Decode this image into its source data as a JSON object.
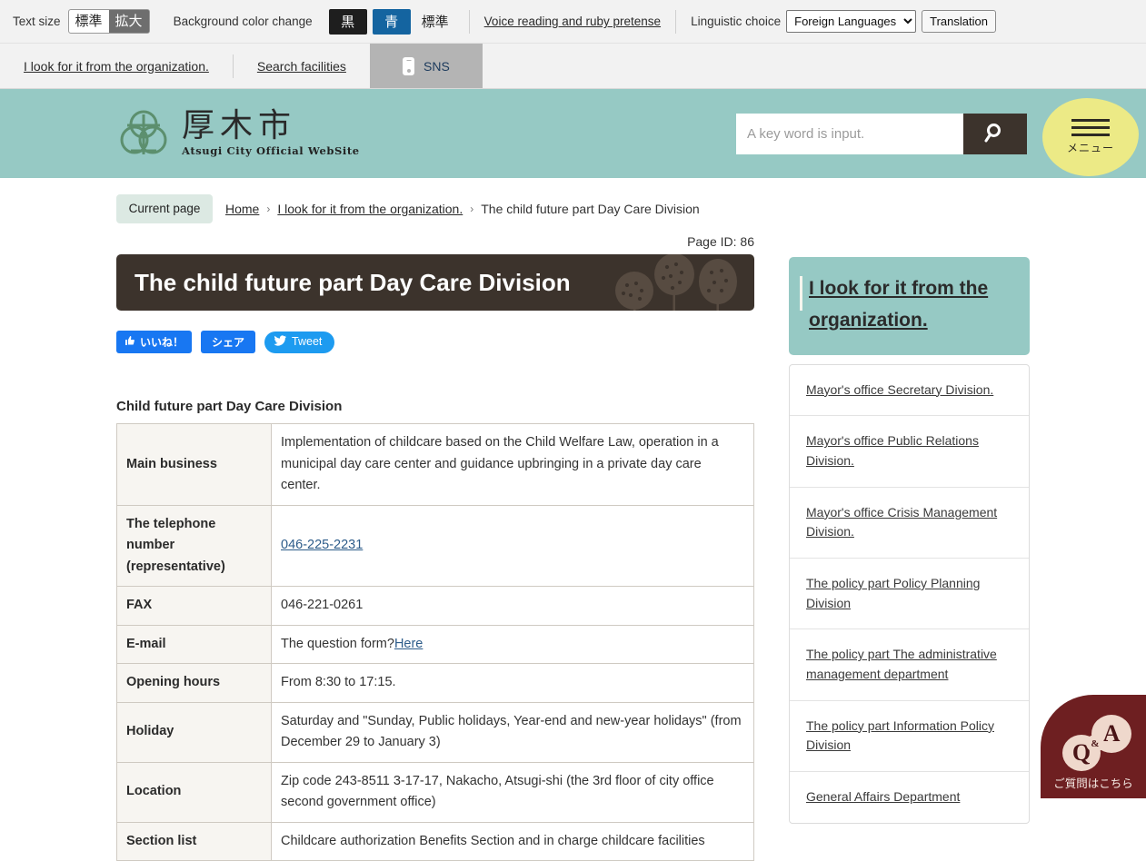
{
  "accessibility_bar": {
    "text_size_label": "Text size",
    "text_size_options": [
      {
        "label": "標準",
        "state": "on"
      },
      {
        "label": "拡大",
        "state": "off"
      }
    ],
    "background_color_label": "Background color change",
    "background_color_options": [
      {
        "label": "黒",
        "color": "#1e1e1e"
      },
      {
        "label": "青",
        "color": "#1464a0"
      },
      {
        "label": "標準",
        "color": "#f2f2f2"
      }
    ],
    "voice_reading_link": "Voice reading and ruby pretense",
    "linguistic_label": "Linguistic choice",
    "linguistic_selected": "Foreign Languages",
    "translation_button": "Translation"
  },
  "tabs": [
    {
      "label": "I look for it from the organization.",
      "active": false
    },
    {
      "label": "Search facilities",
      "active": false
    },
    {
      "label": "SNS",
      "active": true,
      "icon": "phone-icon"
    }
  ],
  "header": {
    "logo_kanji": "厚木市",
    "logo_roman": "Atsugi City Official WebSite",
    "search_placeholder": "A key word is input.",
    "search_value": "",
    "search_icon": "search-icon",
    "menu_label": "メニュー",
    "menu_icon": "hamburger-icon",
    "brand_color": "#96c9c4",
    "menu_blob_color": "#ecea86"
  },
  "breadcrumb": {
    "current_badge": "Current page",
    "items": [
      {
        "label": "Home",
        "link": true
      },
      {
        "label": "I look for it from the organization.",
        "link": true
      },
      {
        "label": "The child future part Day Care Division",
        "link": false
      }
    ],
    "separator": "›"
  },
  "main": {
    "page_id": "Page ID: 86",
    "title": "The child future part Day Care Division",
    "title_bg": "#3c332c",
    "share_buttons": [
      {
        "name": "facebook-like",
        "label": "いいね！",
        "icon": "thumbs-up-icon"
      },
      {
        "name": "facebook-share",
        "label": "シェア"
      },
      {
        "name": "twitter-tweet",
        "label": "Tweet",
        "icon": "twitter-bird-icon"
      }
    ],
    "section_title": "Child future part Day Care Division",
    "table": [
      {
        "header": "Main business",
        "value": "Implementation of childcare based on the Child Welfare Law, operation in a municipal day care center and guidance upbringing in a private day care center."
      },
      {
        "header": "The telephone number (representative)",
        "value": "046-225-2231",
        "link": true
      },
      {
        "header": "FAX",
        "value": "046-221-0261"
      },
      {
        "header": "E-mail",
        "value": "The question form?",
        "link_text": "Here"
      },
      {
        "header": "Opening hours",
        "value": "From 8:30 to 17:15."
      },
      {
        "header": "Holiday",
        "value": "Saturday and \"Sunday, Public holidays, Year-end and new-year holidays\" (from December 29 to January 3)"
      },
      {
        "header": "Location",
        "value": "Zip code 243-8511 3-17-17, Nakacho, Atsugi-shi (the 3rd floor of city office second government office)"
      },
      {
        "header": "Section list",
        "value": "Childcare authorization Benefits Section and in charge childcare facilities"
      }
    ]
  },
  "sidebar": {
    "heading": "I look for it from the organization.",
    "heading_bg": "#96c9c4",
    "items": [
      {
        "label": "Mayor's office Secretary Division."
      },
      {
        "label": "Mayor's office Public Relations Division."
      },
      {
        "label": "Mayor's office Crisis Management Division."
      },
      {
        "label": "The policy part Policy Planning Division"
      },
      {
        "label": "The policy part The administrative management department"
      },
      {
        "label": "The policy part Information Policy Division"
      },
      {
        "label": "General Affairs Department"
      }
    ]
  },
  "qa_badge": {
    "q_letter": "Q",
    "amp": "&",
    "a_letter": "A",
    "caption": "ご質問はこちら",
    "color": "#6e1f21"
  }
}
